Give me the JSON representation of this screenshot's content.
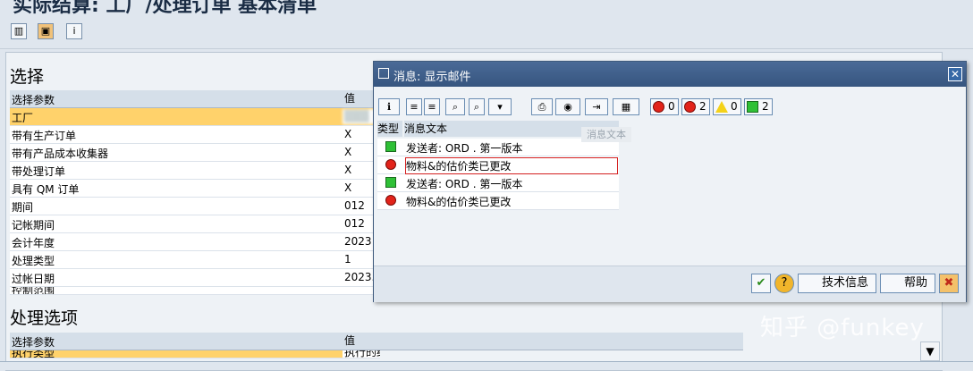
{
  "window": {
    "title": "实际结算: 工厂/处理订单 基本清单"
  },
  "toolbar": {
    "icons": [
      "layout-icon",
      "execute-icon",
      "info-icon"
    ]
  },
  "selection": {
    "title": "选择",
    "header": {
      "param": "选择参数",
      "value": "值"
    },
    "rows": [
      {
        "label": "工厂",
        "value": ""
      },
      {
        "label": "带有生产订单",
        "value": "X"
      },
      {
        "label": "带有产品成本收集器",
        "value": "X"
      },
      {
        "label": "带处理订单",
        "value": "X"
      },
      {
        "label": "具有 QM 订单",
        "value": "X"
      },
      {
        "label": "期间",
        "value": "012"
      },
      {
        "label": "记帐期间",
        "value": "012"
      },
      {
        "label": "会计年度",
        "value": "2023"
      },
      {
        "label": "处理类型",
        "value": "1"
      },
      {
        "label": "过帐日期",
        "value": "2023."
      },
      {
        "label": "控制范围",
        "value": ""
      }
    ]
  },
  "processing": {
    "title": "处理选项",
    "header": {
      "param": "选择参数",
      "value": "值"
    },
    "rows": [
      {
        "label": "执行类型",
        "value": "执行的结算"
      }
    ]
  },
  "dialog": {
    "title": "消息: 显示邮件",
    "status_counts": {
      "stop": "0",
      "error": "2",
      "warning": "0",
      "success": "2"
    },
    "table_header": {
      "type": "类型",
      "text": "消息文本"
    },
    "tooltip": "消息文本",
    "messages": [
      {
        "type": "success",
        "text": "发送者: ORD .                   第一版本"
      },
      {
        "type": "error",
        "text": "物料&的估价类已更改"
      },
      {
        "type": "success",
        "text": "发送者: ORD .                   第一版本"
      },
      {
        "type": "error",
        "text": "物料&的估价类已更改"
      }
    ],
    "buttons": {
      "tech_info": "技术信息",
      "help": "帮助"
    }
  },
  "watermark": "知乎 @funkey"
}
